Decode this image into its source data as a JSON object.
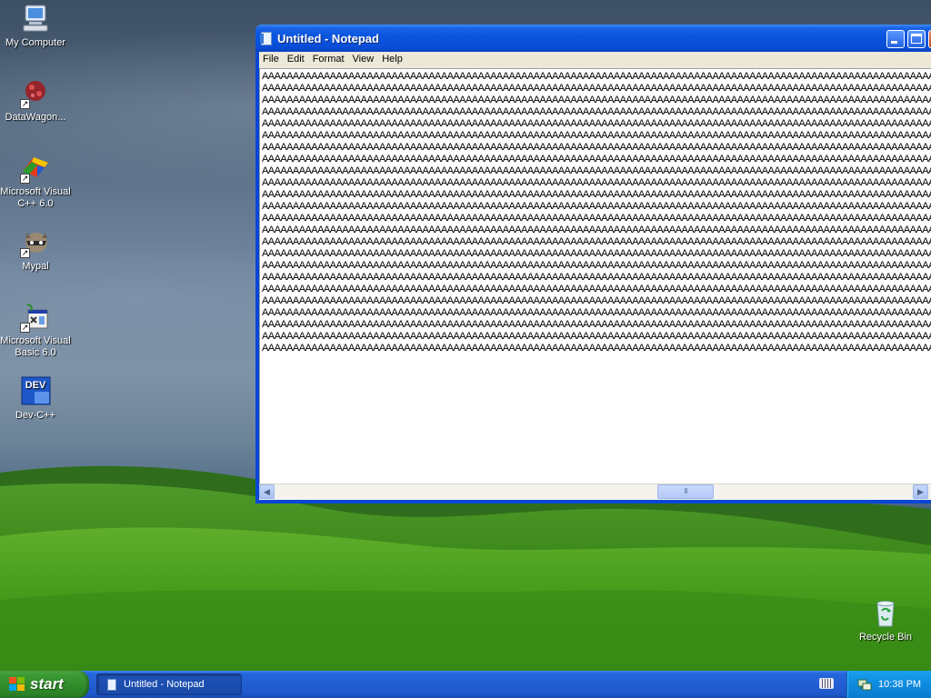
{
  "desktop": {
    "icons": [
      {
        "label": "My Computer",
        "icon": "my-computer-icon"
      },
      {
        "label": "DataWagon...",
        "icon": "datawagon-icon"
      },
      {
        "label": "Microsoft Visual C++ 6.0",
        "icon": "visual-cpp-icon"
      },
      {
        "label": "Mypal",
        "icon": "mypal-icon"
      },
      {
        "label": "Microsoft Visual Basic 6.0",
        "icon": "visual-basic-icon"
      },
      {
        "label": "Dev-C++",
        "icon": "dev-cpp-icon",
        "badge": "DEV"
      }
    ],
    "recycle_bin": {
      "label": "Recycle Bin",
      "icon": "recycle-bin-icon"
    }
  },
  "notepad": {
    "title": "Untitled - Notepad",
    "menu": [
      "File",
      "Edit",
      "Format",
      "View",
      "Help"
    ],
    "content": {
      "char": "A",
      "line_count": 24,
      "chars_per_line": 124
    },
    "scrollbar": {
      "thumb_glyph": "III"
    }
  },
  "taskbar": {
    "start_label": "start",
    "task": {
      "label": "Untitled - Notepad"
    },
    "clock": "10:38 PM"
  },
  "colors": {
    "titlebar": "#0a55df",
    "taskbar": "#225ed2",
    "start": "#3c9a34",
    "tray": "#0f8be0",
    "grass": "#3a9a1e",
    "sky": "#71869e"
  }
}
